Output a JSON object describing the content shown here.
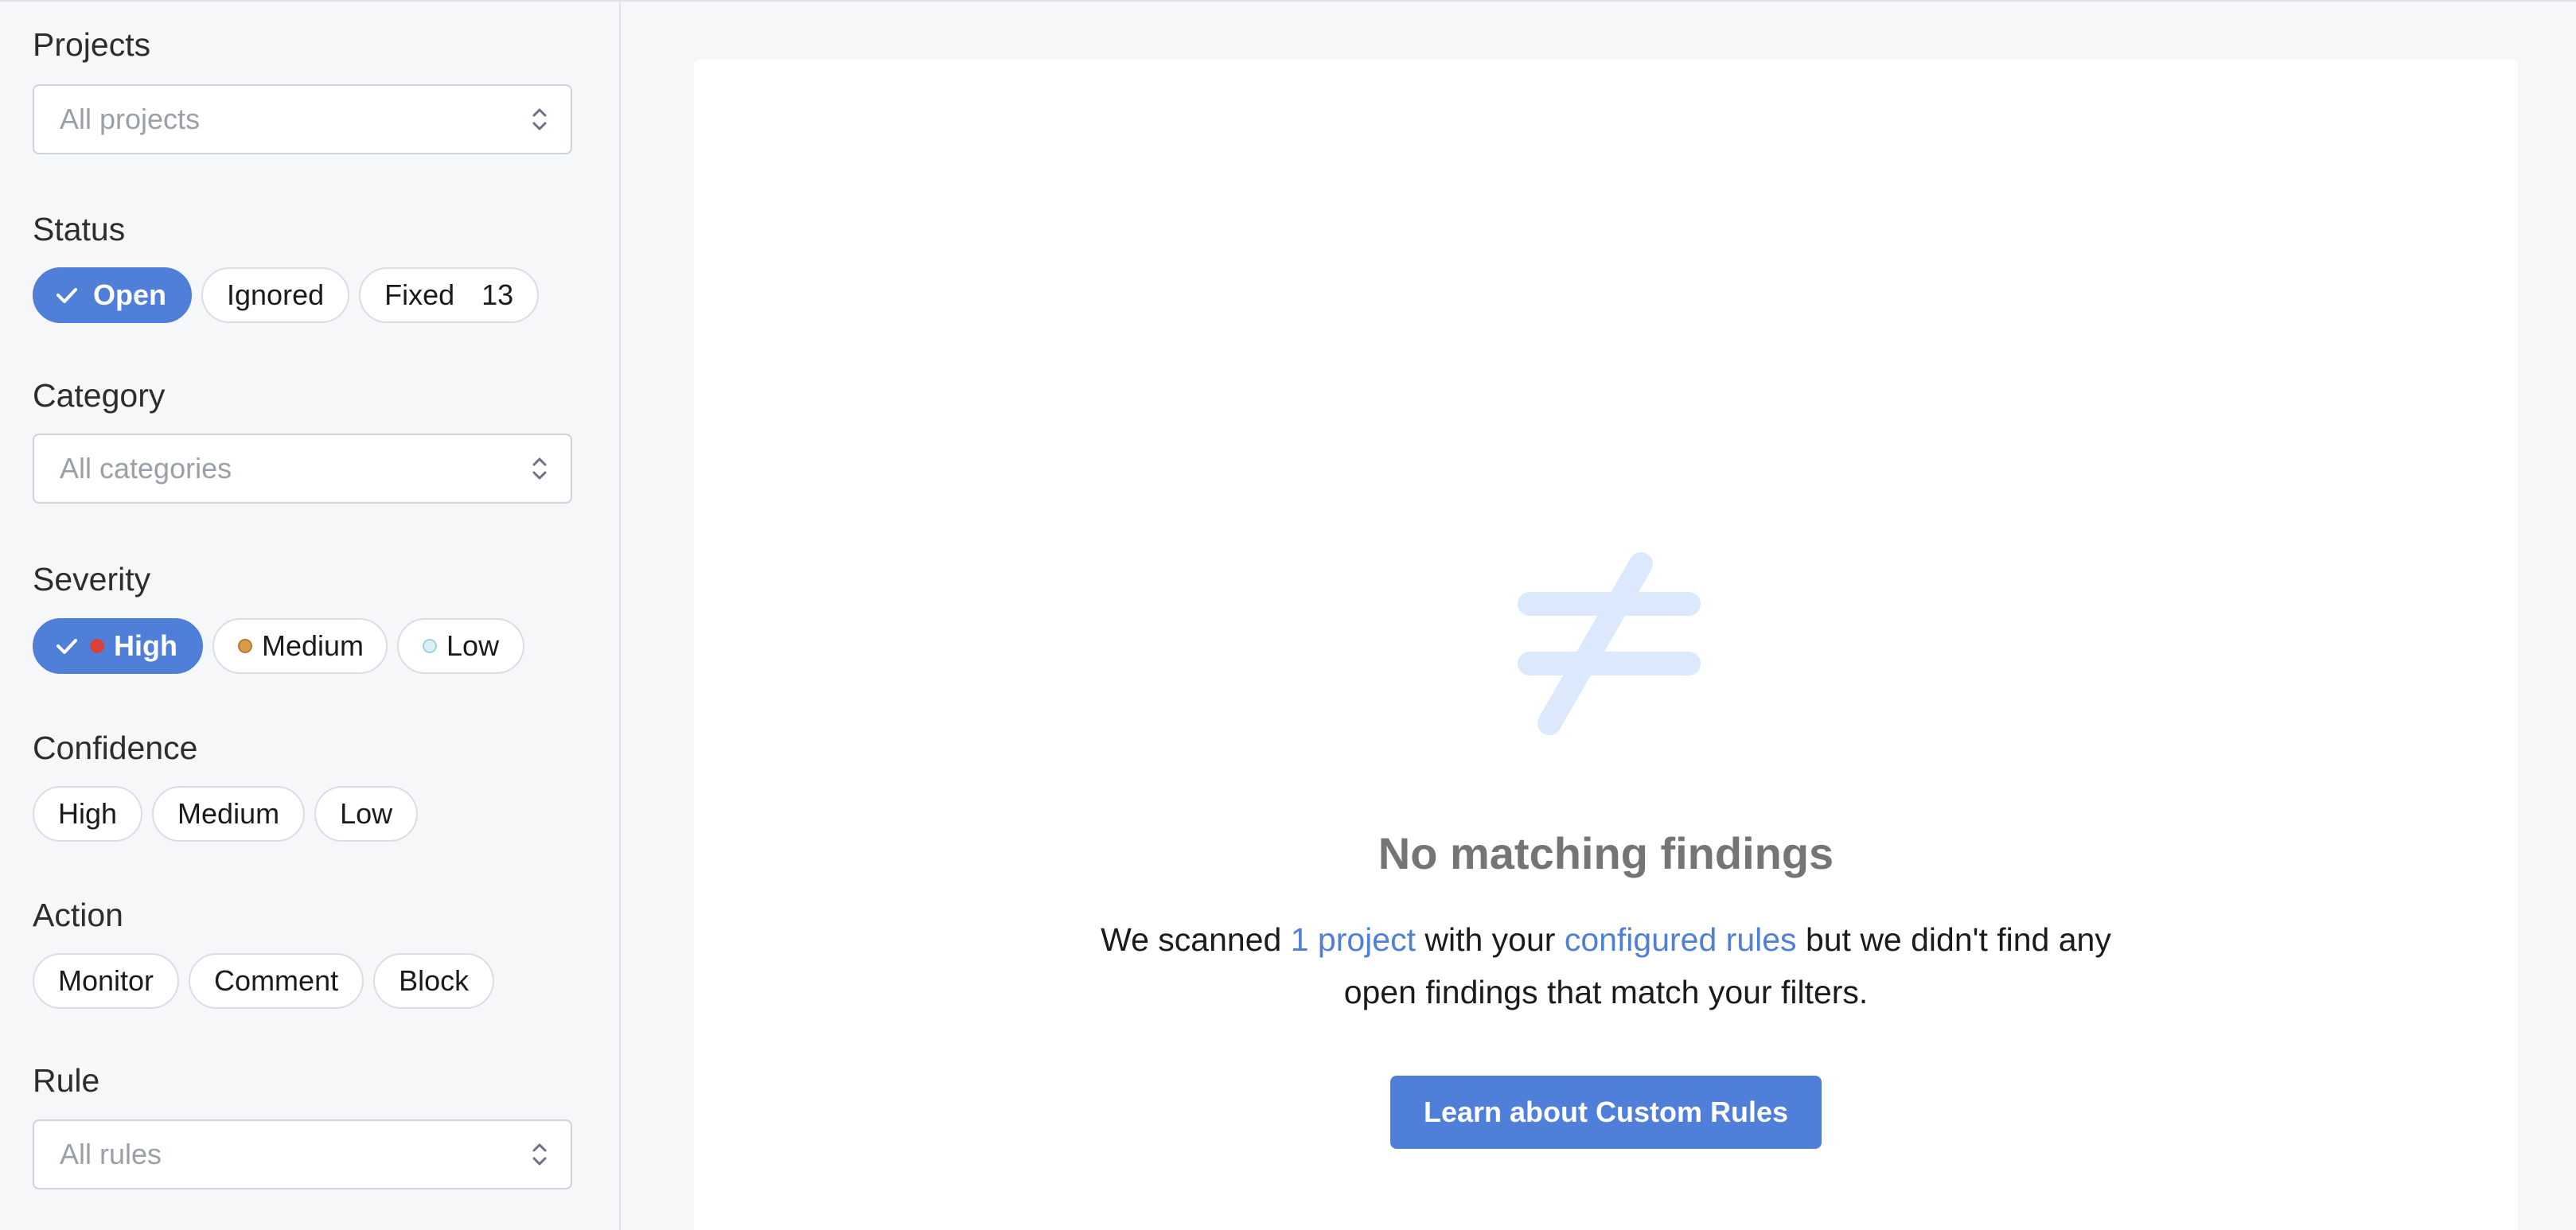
{
  "filters": {
    "projects": {
      "label": "Projects",
      "placeholder": "All projects"
    },
    "status": {
      "label": "Status",
      "options": [
        {
          "label": "Open",
          "selected": true
        },
        {
          "label": "Ignored",
          "selected": false
        },
        {
          "label": "Fixed",
          "count": "13",
          "selected": false
        }
      ]
    },
    "category": {
      "label": "Category",
      "placeholder": "All categories"
    },
    "severity": {
      "label": "Severity",
      "options": [
        {
          "label": "High",
          "selected": true,
          "dot_color": "#d9413a"
        },
        {
          "label": "Medium",
          "selected": false,
          "dot_color": "#d99a4a"
        },
        {
          "label": "Low",
          "selected": false,
          "dot_color": "#cfe9f0"
        }
      ]
    },
    "confidence": {
      "label": "Confidence",
      "options": [
        {
          "label": "High"
        },
        {
          "label": "Medium"
        },
        {
          "label": "Low"
        }
      ]
    },
    "action": {
      "label": "Action",
      "options": [
        {
          "label": "Monitor"
        },
        {
          "label": "Comment"
        },
        {
          "label": "Block"
        }
      ]
    },
    "rule": {
      "label": "Rule",
      "placeholder": "All rules"
    }
  },
  "empty_state": {
    "icon": "not-equal-icon",
    "title": "No matching findings",
    "desc_1": "We scanned ",
    "link_project": "1 project",
    "desc_2": " with your ",
    "link_rules": "configured rules",
    "desc_3": " but we didn't find any",
    "desc_4": "open findings that match your filters.",
    "cta_label": "Learn about Custom Rules"
  },
  "colors": {
    "accent": "#4f7fd8",
    "icon_tint": "#dce9fc"
  }
}
